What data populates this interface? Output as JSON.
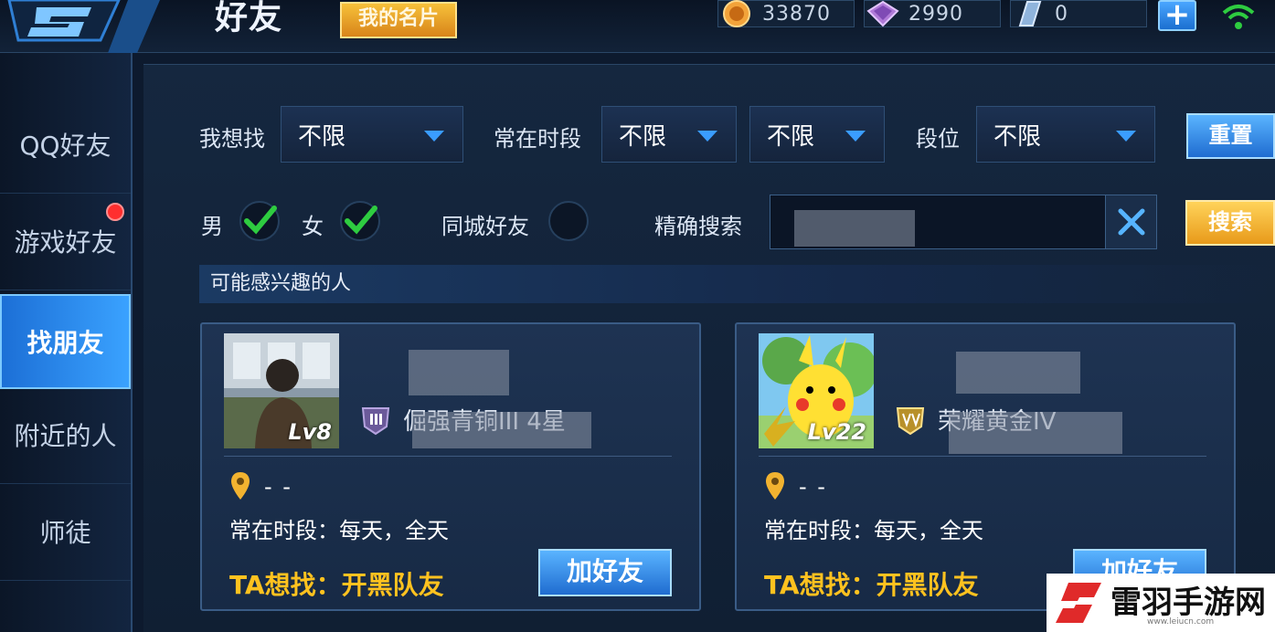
{
  "header": {
    "title": "好友",
    "my_card_label": "我的名片",
    "currencies": [
      {
        "name": "gold-coin-icon",
        "value": "33870"
      },
      {
        "name": "diamond-icon",
        "value": "2990"
      },
      {
        "name": "coupon-icon",
        "value": "0"
      }
    ],
    "plus_label": "+"
  },
  "sidebar": {
    "items": [
      {
        "label": "QQ好友",
        "active": false
      },
      {
        "label": "游戏好友",
        "active": false,
        "notification": true
      },
      {
        "label": "找朋友",
        "active": true
      },
      {
        "label": "附近的人",
        "active": false
      },
      {
        "label": "师徒",
        "active": false
      }
    ]
  },
  "filters": {
    "looking_for_label": "我想找",
    "looking_for_value": "不限",
    "online_time_label": "常在时段",
    "online_time_value1": "不限",
    "online_time_value2": "不限",
    "rank_label": "段位",
    "rank_value": "不限",
    "reset_label": "重置",
    "male_label": "男",
    "female_label": "女",
    "male_checked": true,
    "female_checked": true,
    "same_city_label": "同城好友",
    "same_city_checked": false,
    "exact_search_label": "精确搜索",
    "search_label": "搜索"
  },
  "section": {
    "title": "可能感兴趣的人"
  },
  "cards": [
    {
      "level": "Lv8",
      "rank_text": "倔强青铜III 4星",
      "location": "- -",
      "online_time": "常在时段：每天，全天",
      "wants": "TA想找：开黑队友",
      "add_label": "加好友"
    },
    {
      "level": "Lv22",
      "rank_text": "荣耀黄金IV",
      "location": "- -",
      "online_time": "常在时段：每天，全天",
      "wants": "TA想找：开黑队友",
      "add_label": "加好友"
    }
  ],
  "watermark": {
    "text": "雷羽手游网",
    "url": "www.leiucn.com"
  },
  "colors": {
    "accent_blue": "#3aa2ff",
    "gold": "#ffc21f",
    "check_green": "#2ecc40"
  }
}
